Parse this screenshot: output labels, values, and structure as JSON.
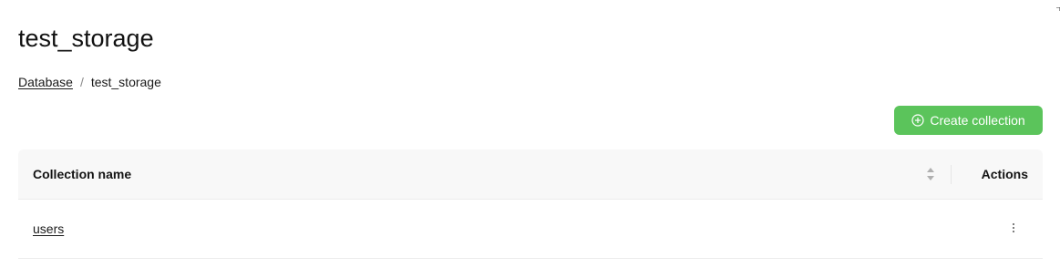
{
  "page": {
    "title": "test_storage"
  },
  "breadcrumb": {
    "items": [
      {
        "label": "Database",
        "link": true
      },
      {
        "label": "test_storage",
        "link": false
      }
    ],
    "separator": "/"
  },
  "toolbar": {
    "create_label": "Create collection",
    "create_icon": "plus-circle-icon",
    "accent_color": "#5bc45b"
  },
  "table": {
    "columns": [
      {
        "label": "Collection name",
        "sortable": true
      },
      {
        "label": "Actions"
      }
    ],
    "rows": [
      {
        "name": "users",
        "actions_icon": "more-vertical-icon"
      }
    ]
  }
}
